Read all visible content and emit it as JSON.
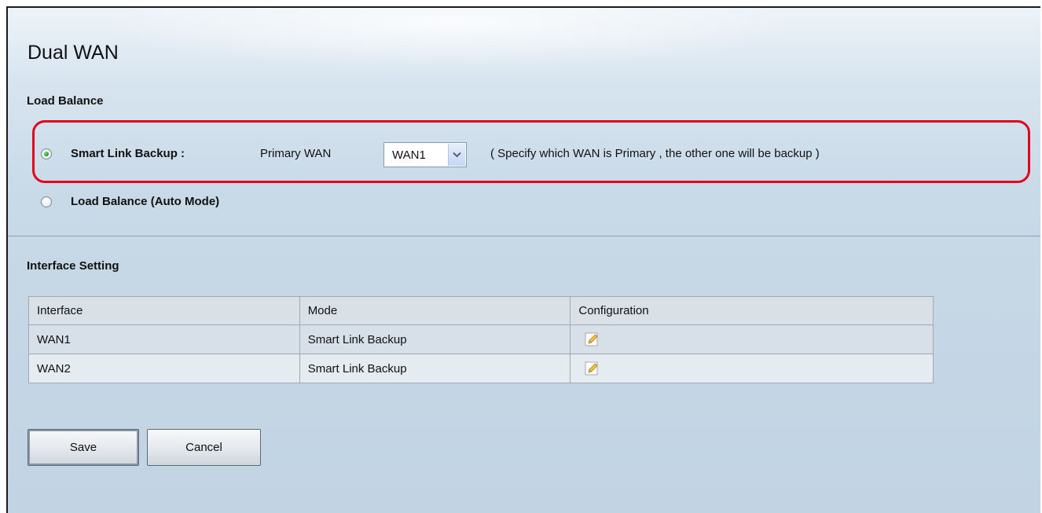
{
  "page": {
    "title": "Dual WAN"
  },
  "load_balance": {
    "heading": "Load Balance",
    "smart_link_backup": {
      "label": "Smart Link Backup :",
      "selected": true,
      "primary_wan_label": "Primary WAN",
      "primary_wan_value": "WAN1",
      "hint": "( Specify which WAN is Primary , the other one will be backup )"
    },
    "auto_mode": {
      "label": "Load Balance (Auto Mode)",
      "selected": false
    }
  },
  "interface_setting": {
    "heading": "Interface Setting",
    "columns": [
      "Interface",
      "Mode",
      "Configuration"
    ],
    "rows": [
      {
        "interface": "WAN1",
        "mode": "Smart Link Backup",
        "config_icon": "edit-icon"
      },
      {
        "interface": "WAN2",
        "mode": "Smart Link Backup",
        "config_icon": "edit-icon"
      }
    ]
  },
  "buttons": {
    "save": "Save",
    "cancel": "Cancel"
  },
  "colors": {
    "highlight": "#e3001b",
    "radio_selected": "#1a9a1a",
    "background": "#c8d9e7"
  }
}
